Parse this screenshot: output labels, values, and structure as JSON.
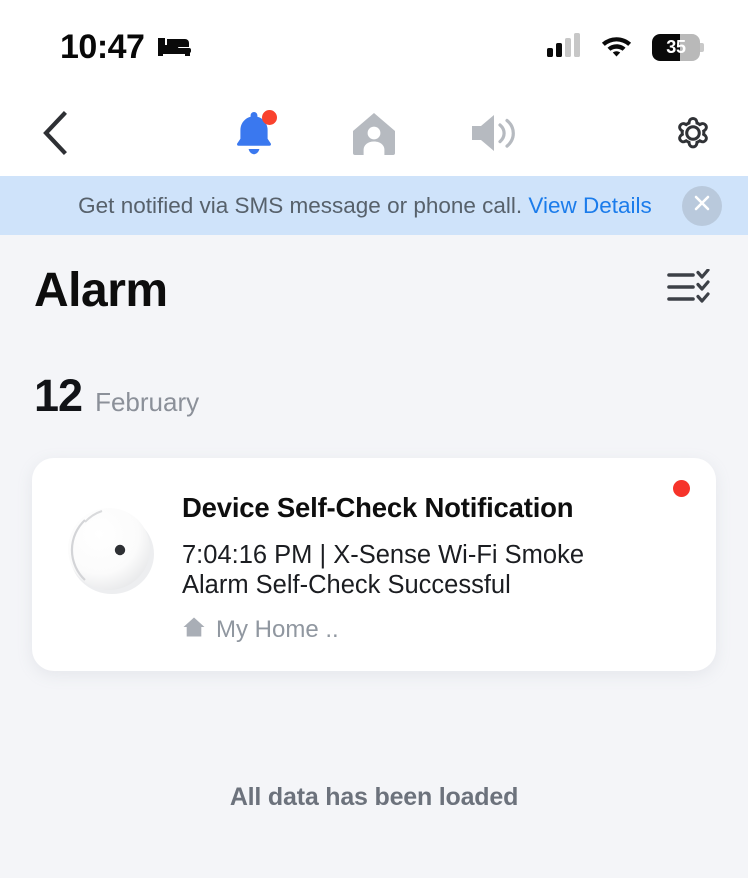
{
  "status_bar": {
    "time": "10:47",
    "alarm_icon": "bed-icon",
    "signal_icon": "cellular-signal-icon",
    "wifi_icon": "wifi-icon",
    "battery_level": "35",
    "battery_percent": 35
  },
  "nav_bar": {
    "back_icon": "chevron-left-icon",
    "items": [
      {
        "icon": "bell-icon",
        "label": "Alarm notifications",
        "active": true,
        "has_badge": true
      },
      {
        "icon": "home-person-icon",
        "label": "Family",
        "active": false,
        "has_badge": false
      },
      {
        "icon": "speaker-icon",
        "label": "Sound",
        "active": false,
        "has_badge": false
      }
    ],
    "settings_icon": "gear-icon",
    "active_color": "#3a78ef",
    "inactive_color": "#b6bac0"
  },
  "banner": {
    "message": "Get notified via SMS message or phone call.",
    "link_label": "View Details",
    "close_icon": "close-icon",
    "background": "#cfe3fa",
    "link_color": "#1b7ceb"
  },
  "header": {
    "title": "Alarm",
    "filter_icon": "filter-checklist-icon"
  },
  "date_group": {
    "day": "12",
    "month": "February"
  },
  "notifications": [
    {
      "device_icon": "smoke-detector-icon",
      "title": "Device Self-Check Notification",
      "description": "7:04:16 PM | X-Sense Wi-Fi Smoke Alarm Self-Check Successful",
      "home_icon": "home-icon",
      "home_label": "My Home ..",
      "unread": true,
      "unread_color": "#f6332a"
    }
  ],
  "footer": {
    "end_of_list_label": "All data has been loaded"
  },
  "theme": {
    "page_background": "#f4f5f8",
    "card_background": "#ffffff",
    "accent_blue": "#3a78ef"
  }
}
